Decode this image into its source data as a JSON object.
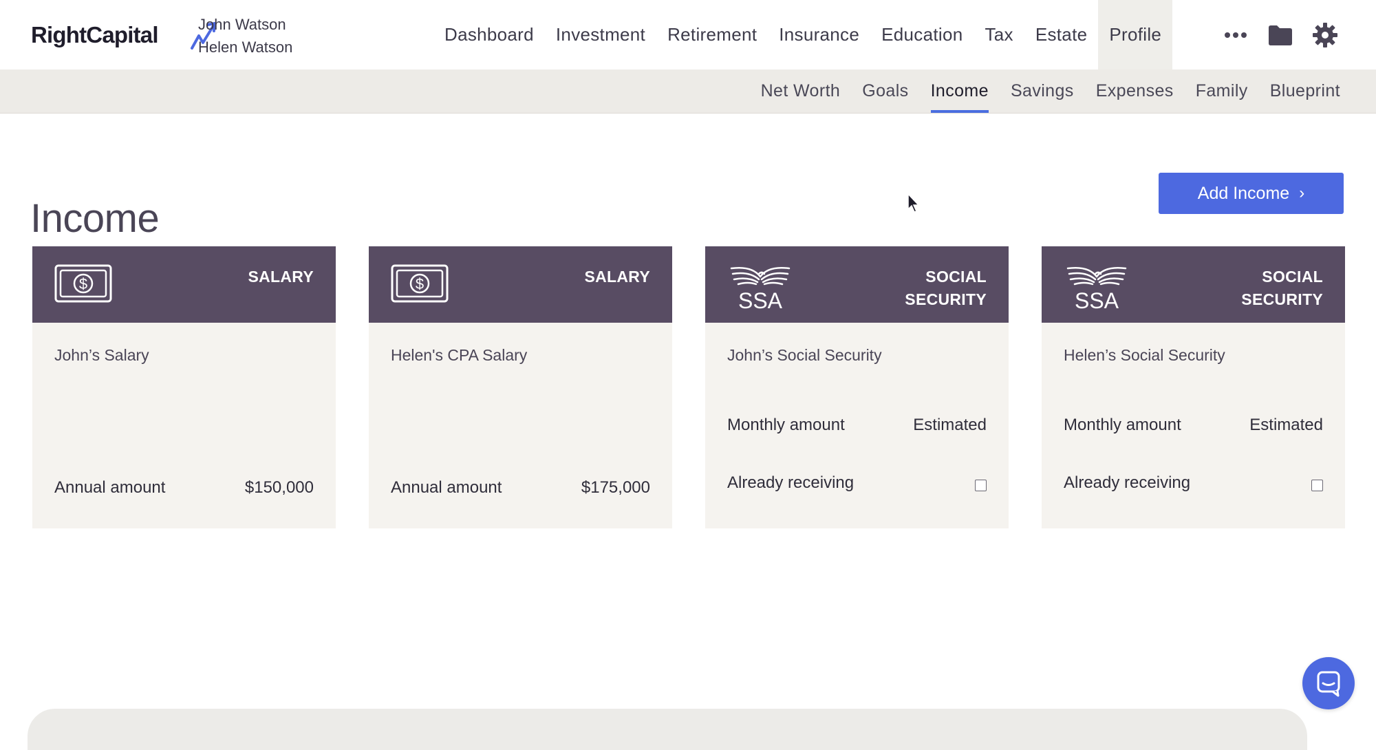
{
  "brand": {
    "logo_text": "RightCapital"
  },
  "clients": {
    "primary": "John Watson",
    "spouse": "Helen Watson"
  },
  "main_nav": {
    "items": [
      "Dashboard",
      "Investment",
      "Retirement",
      "Insurance",
      "Education",
      "Tax",
      "Estate",
      "Profile"
    ],
    "active": "Profile",
    "icons": [
      "more-icon",
      "folder-icon",
      "gear-icon"
    ]
  },
  "sub_nav": {
    "items": [
      "Net Worth",
      "Goals",
      "Income",
      "Savings",
      "Expenses",
      "Family",
      "Blueprint"
    ],
    "active": "Income"
  },
  "page": {
    "title": "Income",
    "add_button": "Add Income"
  },
  "cards": [
    {
      "type": "SALARY",
      "name": "John’s Salary",
      "label": "Annual amount",
      "value": "$150,000",
      "icon": "cash-icon"
    },
    {
      "type": "SALARY",
      "name": "Helen's CPA Salary",
      "label": "Annual amount",
      "value": "$175,000",
      "icon": "cash-icon"
    },
    {
      "type_line1": "SOCIAL",
      "type_line2": "SECURITY",
      "name": "John’s Social Security",
      "label": "Monthly amount",
      "value": "Estimated",
      "receiving_label": "Already receiving",
      "receiving": false,
      "icon": "ssa-eagle-icon",
      "icon_text": "SSA"
    },
    {
      "type_line1": "SOCIAL",
      "type_line2": "SECURITY",
      "name": "Helen’s Social Security",
      "label": "Monthly amount",
      "value": "Estimated",
      "receiving_label": "Already receiving",
      "receiving": false,
      "icon": "ssa-eagle-icon",
      "icon_text": "SSA"
    }
  ],
  "colors": {
    "accent": "#4d69e0",
    "card_header": "#584c63",
    "card_body": "#f5f3ef",
    "subnav_bg": "#edebe7"
  }
}
